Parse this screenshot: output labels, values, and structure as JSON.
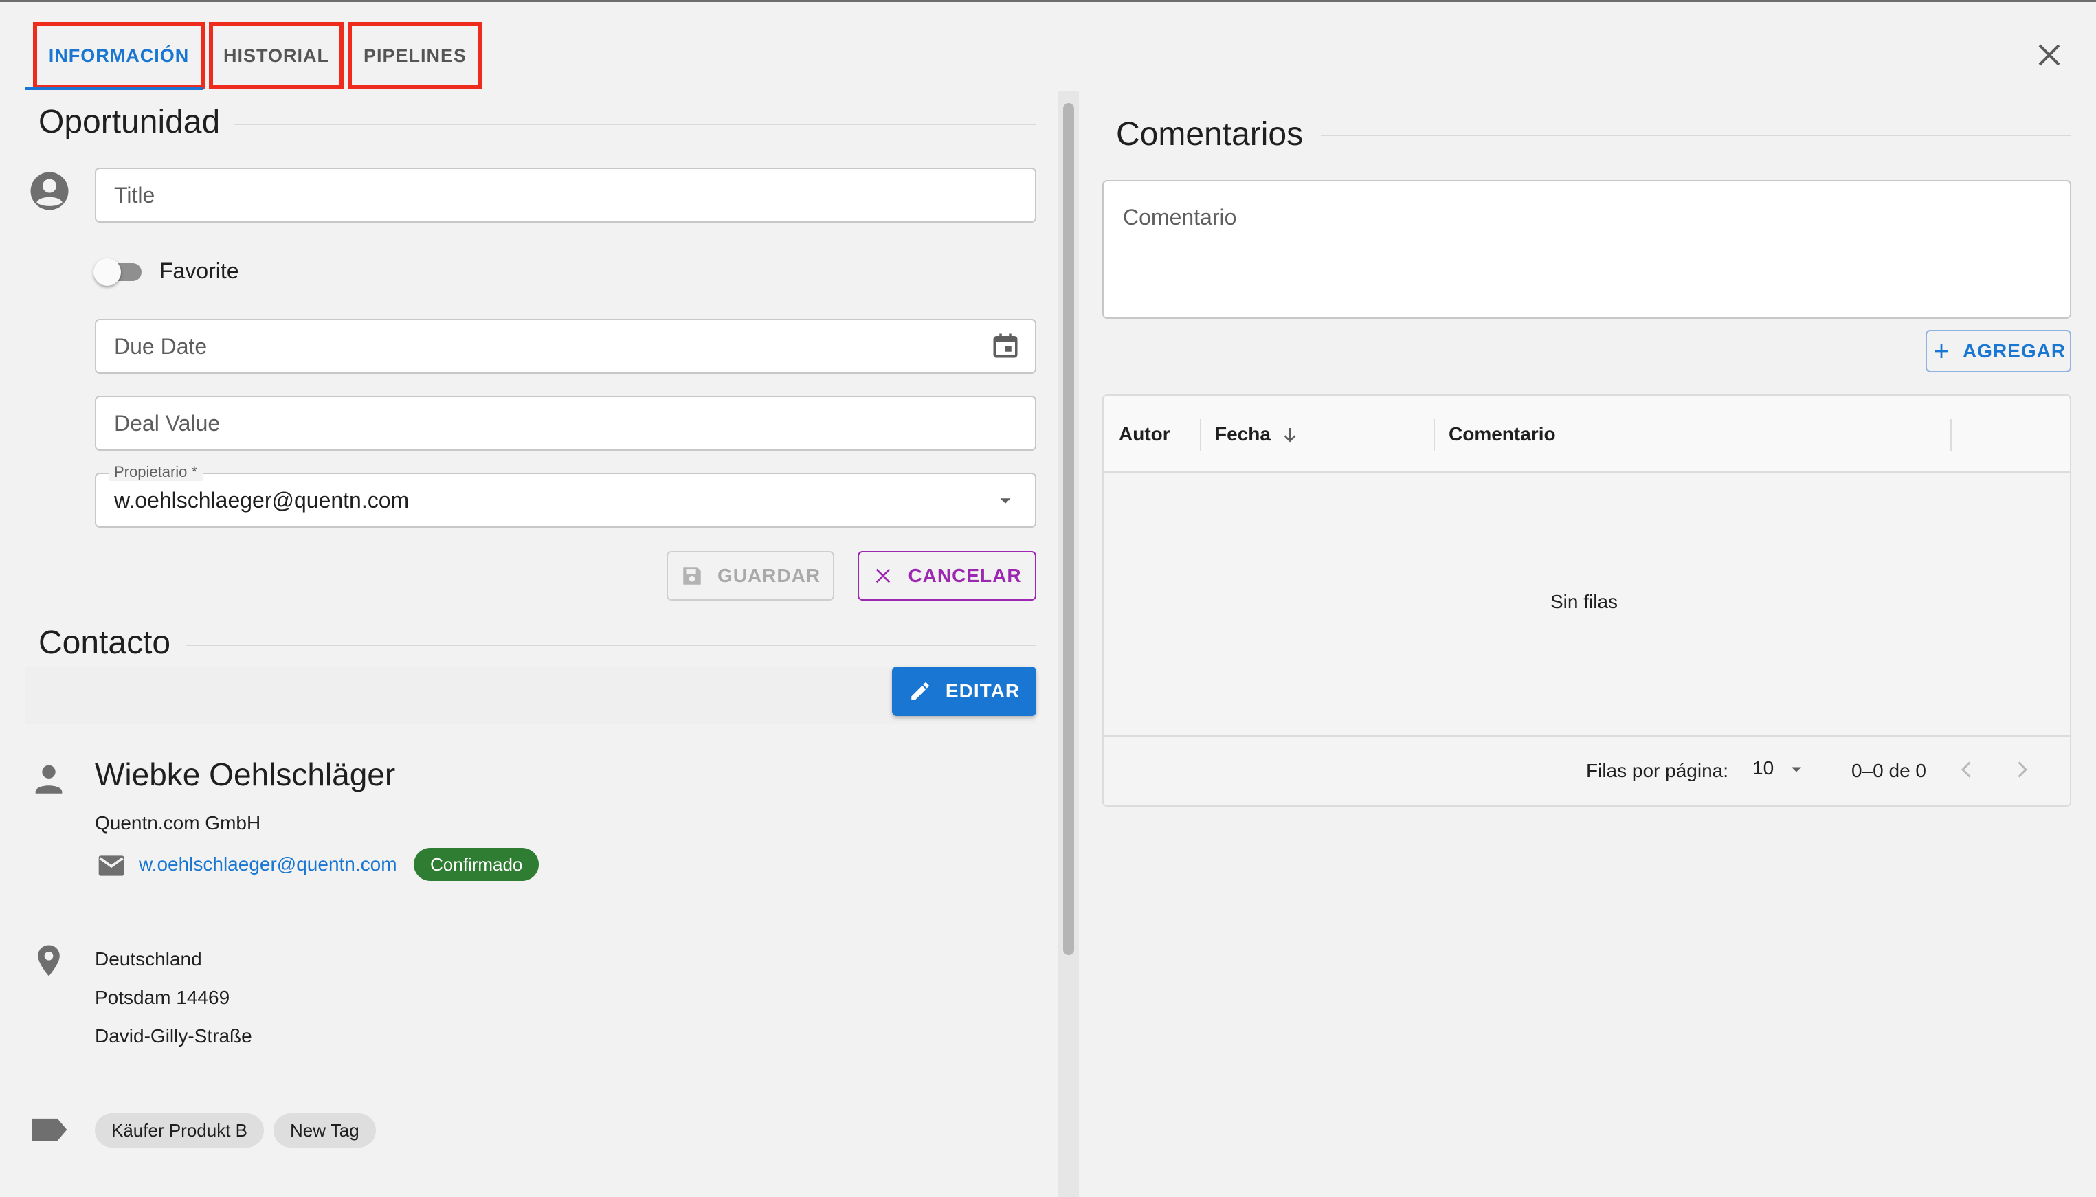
{
  "tabs": [
    {
      "label": "INFORMACIÓN",
      "active": true
    },
    {
      "label": "HISTORIAL",
      "active": false
    },
    {
      "label": "PIPELINES",
      "active": false
    }
  ],
  "opportunity": {
    "heading": "Oportunidad",
    "title_placeholder": "Title",
    "favorite_label": "Favorite",
    "favorite_on": false,
    "due_date_placeholder": "Due Date",
    "deal_value_placeholder": "Deal Value",
    "owner_label": "Propietario *",
    "owner_value": "w.oehlschlaeger@quentn.com",
    "save_label": "GUARDAR",
    "cancel_label": "CANCELAR"
  },
  "contact": {
    "heading": "Contacto",
    "edit_label": "EDITAR",
    "name": "Wiebke Oehlschläger",
    "company": "Quentn.com GmbH",
    "email": "w.oehlschlaeger@quentn.com",
    "email_status": "Confirmado",
    "address": {
      "country": "Deutschland",
      "city": "Potsdam 14469",
      "street": "David-Gilly-Straße"
    },
    "tags": [
      "Käufer Produkt B",
      "New Tag"
    ]
  },
  "comments": {
    "heading": "Comentarios",
    "input_placeholder": "Comentario",
    "add_label": "AGREGAR",
    "columns": [
      "Autor",
      "Fecha",
      "Comentario"
    ],
    "empty_text": "Sin filas",
    "rows_per_page_label": "Filas por página:",
    "rows_per_page_value": "10",
    "range_text": "0–0 de 0"
  },
  "colors": {
    "primary": "#1976d2",
    "tab_highlight": "#ee2b1c",
    "cancel": "#9c27b0",
    "confirmed": "#2e7d32"
  }
}
